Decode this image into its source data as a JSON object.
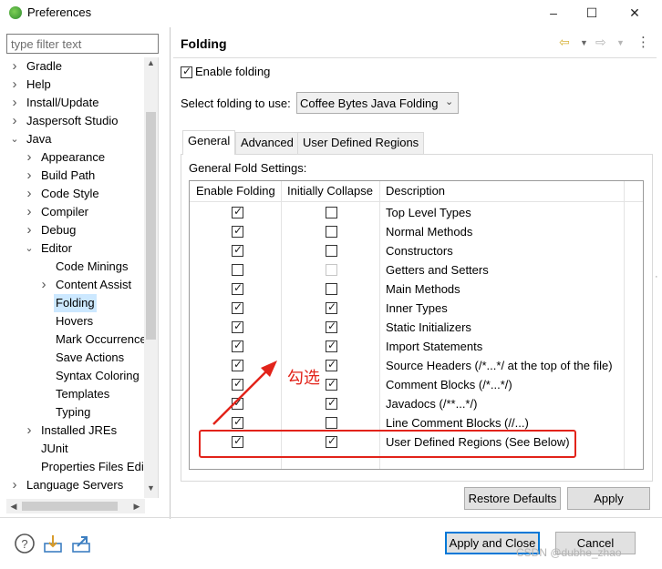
{
  "window": {
    "title": "Preferences",
    "controls": [
      "minimize",
      "maximize",
      "close"
    ]
  },
  "sidebar": {
    "filter_placeholder": "type filter text",
    "items": [
      {
        "label": "Gradle",
        "expander": "collapsed",
        "depth": 0
      },
      {
        "label": "Help",
        "expander": "collapsed",
        "depth": 0
      },
      {
        "label": "Install/Update",
        "expander": "collapsed",
        "depth": 0
      },
      {
        "label": "Jaspersoft Studio",
        "expander": "collapsed",
        "depth": 0
      },
      {
        "label": "Java",
        "expander": "expanded",
        "depth": 0
      },
      {
        "label": "Appearance",
        "expander": "collapsed",
        "depth": 1
      },
      {
        "label": "Build Path",
        "expander": "collapsed",
        "depth": 1
      },
      {
        "label": "Code Style",
        "expander": "collapsed",
        "depth": 1
      },
      {
        "label": "Compiler",
        "expander": "collapsed",
        "depth": 1
      },
      {
        "label": "Debug",
        "expander": "collapsed",
        "depth": 1
      },
      {
        "label": "Editor",
        "expander": "expanded",
        "depth": 1
      },
      {
        "label": "Code Minings",
        "expander": "none",
        "depth": 2
      },
      {
        "label": "Content Assist",
        "expander": "collapsed",
        "depth": 2
      },
      {
        "label": "Folding",
        "expander": "none",
        "depth": 2,
        "selected": true
      },
      {
        "label": "Hovers",
        "expander": "none",
        "depth": 2
      },
      {
        "label": "Mark Occurrence",
        "expander": "none",
        "depth": 2
      },
      {
        "label": "Save Actions",
        "expander": "none",
        "depth": 2
      },
      {
        "label": "Syntax Coloring",
        "expander": "none",
        "depth": 2
      },
      {
        "label": "Templates",
        "expander": "none",
        "depth": 2
      },
      {
        "label": "Typing",
        "expander": "none",
        "depth": 2
      },
      {
        "label": "Installed JREs",
        "expander": "collapsed",
        "depth": 1
      },
      {
        "label": "JUnit",
        "expander": "none",
        "depth": 1
      },
      {
        "label": "Properties Files Edi",
        "expander": "none",
        "depth": 1
      },
      {
        "label": "Language Servers",
        "expander": "collapsed",
        "depth": 0
      }
    ]
  },
  "page": {
    "title": "Folding",
    "enable_folding_label": "Enable folding",
    "enable_folding_checked": true,
    "select_label": "Select folding to use:",
    "select_value": "Coffee Bytes Java Folding",
    "tabs": [
      {
        "label": "General",
        "active": true
      },
      {
        "label": "Advanced",
        "active": false
      },
      {
        "label": "User Defined Regions",
        "active": false
      }
    ],
    "section_label": "General Fold Settings:",
    "table": {
      "headers": [
        "Enable Folding",
        "Initially Collapse",
        "Description"
      ],
      "rows": [
        {
          "enable": true,
          "collapse": false,
          "collapse_disabled": false,
          "description": "Top Level Types"
        },
        {
          "enable": true,
          "collapse": false,
          "collapse_disabled": false,
          "description": "Normal Methods"
        },
        {
          "enable": true,
          "collapse": false,
          "collapse_disabled": false,
          "description": "Constructors"
        },
        {
          "enable": false,
          "collapse": false,
          "collapse_disabled": true,
          "description": "Getters and Setters"
        },
        {
          "enable": true,
          "collapse": false,
          "collapse_disabled": false,
          "description": "Main Methods"
        },
        {
          "enable": true,
          "collapse": true,
          "collapse_disabled": false,
          "description": "Inner Types"
        },
        {
          "enable": true,
          "collapse": true,
          "collapse_disabled": false,
          "description": "Static Initializers"
        },
        {
          "enable": true,
          "collapse": true,
          "collapse_disabled": false,
          "description": "Import Statements"
        },
        {
          "enable": true,
          "collapse": true,
          "collapse_disabled": false,
          "description": "Source Headers (/*...*/ at the top of the file)"
        },
        {
          "enable": true,
          "collapse": true,
          "collapse_disabled": false,
          "description": "Comment Blocks (/*...*/)"
        },
        {
          "enable": true,
          "collapse": true,
          "collapse_disabled": false,
          "description": "Javadocs (/**...*/)"
        },
        {
          "enable": true,
          "collapse": false,
          "collapse_disabled": false,
          "description": "Line Comment Blocks (//...)"
        },
        {
          "enable": true,
          "collapse": true,
          "collapse_disabled": false,
          "description": "User Defined Regions (See Below)"
        }
      ]
    },
    "restore_defaults_label": "Restore Defaults",
    "apply_label": "Apply"
  },
  "footer": {
    "apply_close_label": "Apply and Close",
    "cancel_label": "Cancel"
  },
  "annotation": {
    "text": "勾选",
    "color": "#e2231a"
  },
  "watermark": "CSDN @dubhe_zhao",
  "colors": {
    "selection": "#cce8ff",
    "default_button_border": "#0078d7",
    "button_face": "#e1e1e1"
  }
}
